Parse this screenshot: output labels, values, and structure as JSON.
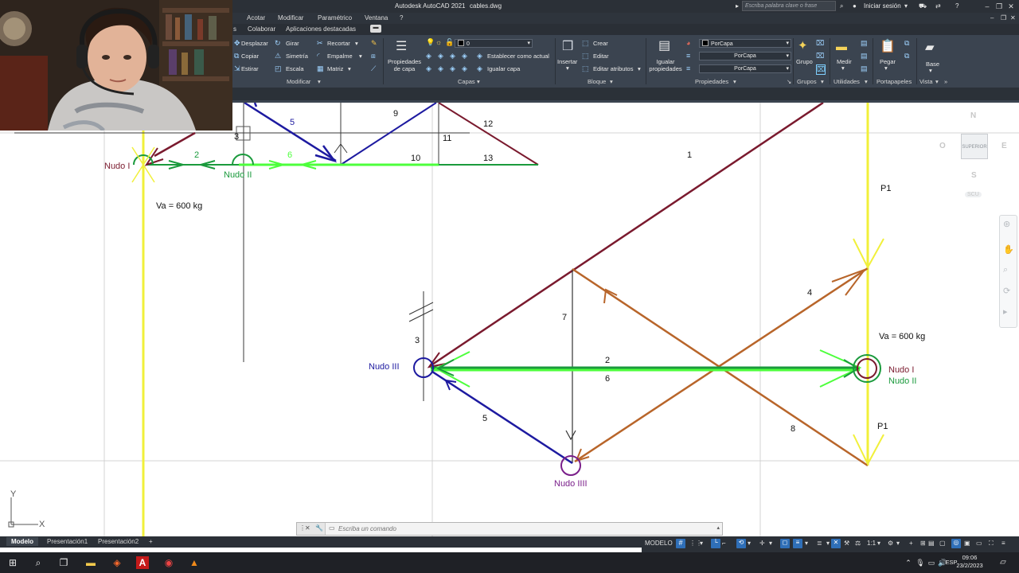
{
  "window": {
    "title": "Autodesk AutoCAD 2021",
    "file": "cables.dwg",
    "search_placeholder": "Escriba palabra clave o frase",
    "signin": "Iniciar sesión"
  },
  "menu": [
    "Acotar",
    "Modificar",
    "Paramétrico",
    "Ventana",
    "?"
  ],
  "ribbon_tabs": [
    "s",
    "Colaborar",
    "Aplicaciones destacadas"
  ],
  "ribbon": {
    "modify": {
      "rows": [
        [
          "Desplazar",
          "Girar",
          "Recortar"
        ],
        [
          "Copiar",
          "Simetría",
          "Empalme"
        ],
        [
          "Estirar",
          "Escala",
          "Matriz"
        ]
      ],
      "group": "Modificar"
    },
    "layers": {
      "properties": "Propiedades de capa",
      "current_layer": "0",
      "set_current": "Establecer como actual",
      "match": "Igualar capa",
      "group": "Capas"
    },
    "block": {
      "insert": "Insertar",
      "create": "Crear",
      "edit": "Editar",
      "edit_attributes": "Editar atributos",
      "group": "Bloque"
    },
    "properties": {
      "match": "Igualar propiedades",
      "bylayer": [
        "PorCapa",
        "PorCapa",
        "PorCapa"
      ],
      "group": "Propiedades"
    },
    "groups": {
      "label": "Grupo",
      "group": "Grupos"
    },
    "utilities": {
      "label": "Medir",
      "group": "Utilidades"
    },
    "clipboard": {
      "label": "Pegar",
      "group": "Portapapeles"
    },
    "view": {
      "label": "Base",
      "group": "Vista"
    }
  },
  "colors": {
    "maroon": "#7a1a2e",
    "blue": "#1d1aa0",
    "green": "#1a9a3c",
    "bright_green": "#4dff3c",
    "orange": "#b8652a",
    "purple": "#7a1f8a",
    "yellow": "#f1f03a"
  },
  "drawing": {
    "top_left": {
      "member_labels": [
        "5",
        "9",
        "12",
        "3",
        "11",
        "2",
        "6",
        "10",
        "13"
      ],
      "nudo_i": "Nudo I",
      "nudo_ii": "Nudo II",
      "va": "Va = 600 kg"
    },
    "main": {
      "member_1": "1",
      "member_3": "3",
      "member_4": "4",
      "member_5": "5",
      "member_7": "7",
      "member_8": "8",
      "member_2": "2",
      "member_6": "6",
      "p1_top": "P1",
      "p1_bottom": "P1",
      "va": "Va = 600 kg",
      "nudo_i": "Nudo I",
      "nudo_ii": "Nudo II",
      "nudo_iii": "Nudo III",
      "nudo_iiii": "Nudo IIII"
    },
    "ucs": {
      "x": "X",
      "y": "Y"
    }
  },
  "viewcube": {
    "n": "N",
    "s": "S",
    "e": "E",
    "w": "O",
    "top": "SUPERIOR",
    "ucs": "SCU"
  },
  "command": {
    "placeholder": "Escriba un comando"
  },
  "layouts": [
    "Modelo",
    "Presentación1",
    "Presentación2",
    "+"
  ],
  "status": {
    "model": "MODELO",
    "scale": "1:1"
  },
  "taskbar": {
    "lang": "ESP",
    "time": "09:06",
    "date": "23/2/2023"
  }
}
